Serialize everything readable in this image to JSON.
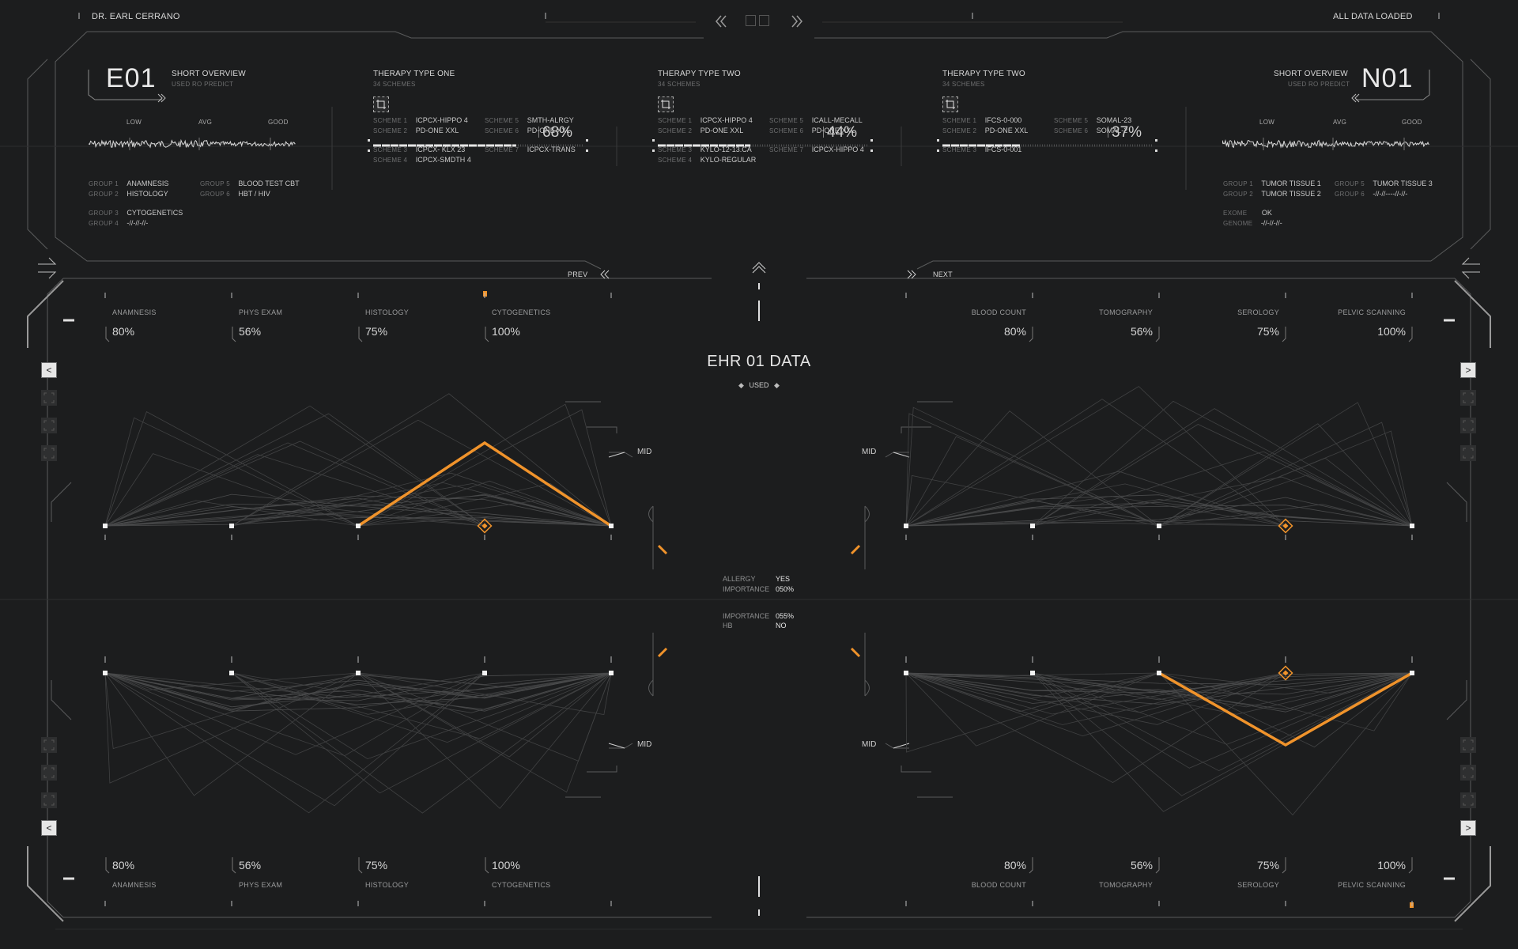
{
  "header": {
    "user": "DR. EARL CERRANO",
    "status": "ALL DATA LOADED",
    "prev_icon": "double-chevron-left-icon",
    "next_icon": "double-chevron-right-icon"
  },
  "top_left": {
    "code": "E01",
    "title": "SHORT OVERVIEW",
    "subtitle": "USED RO PREDICT",
    "scale": [
      "LOW",
      "AVG",
      "GOOD"
    ],
    "groups": [
      {
        "k": "GROUP 1",
        "v": "ANAMNESIS"
      },
      {
        "k": "GROUP 5",
        "v": "BLOOD TEST CBT"
      },
      {
        "k": "GROUP 2",
        "v": "HISTOLOGY"
      },
      {
        "k": "GROUP 6",
        "v": "HBT / HIV"
      },
      {
        "k": "GROUP 3",
        "v": "CYTOGENETICS"
      },
      {
        "k": "GROUP 4",
        "v": "-//-//-//-"
      }
    ]
  },
  "top_right": {
    "code": "N01",
    "title": "SHORT OVERVIEW",
    "subtitle": "USED RO PREDICT",
    "scale": [
      "LOW",
      "AVG",
      "GOOD"
    ],
    "groups": [
      {
        "k": "GROUP 1",
        "v": "TUMOR TISSUE 1"
      },
      {
        "k": "GROUP 5",
        "v": "TUMOR TISSUE 3"
      },
      {
        "k": "GROUP 2",
        "v": "TUMOR TISSUE 2"
      },
      {
        "k": "GROUP 6",
        "v": "-//-//----//-//-"
      },
      {
        "k": "EXOME",
        "v": "OK"
      },
      {
        "k": "GENOME",
        "v": "-//-//-//-"
      }
    ]
  },
  "therapies": [
    {
      "title": "THERAPY TYPE ONE",
      "subtitle": "34 SCHEMES",
      "percent": "68%",
      "fill": 0.68,
      "schemes": [
        {
          "k": "SCHEME 1",
          "v": "ICPCX-HIPPO 4"
        },
        {
          "k": "SCHEME 5",
          "v": "SMTH-ALRGY"
        },
        {
          "k": "SCHEME 2",
          "v": "PD-ONE XXL"
        },
        {
          "k": "SCHEME 6",
          "v": "PD-ONE XXL"
        },
        {
          "k": "SCHEME 3",
          "v": "ICPCX- KLX 23"
        },
        {
          "k": "SCHEME 7",
          "v": "ICPCX-TRANS"
        },
        {
          "k": "SCHEME 4",
          "v": "ICPCX-SMDTH 4"
        }
      ]
    },
    {
      "title": "THERAPY TYPE TWO",
      "subtitle": "34 SCHEMES",
      "percent": "44%",
      "fill": 0.44,
      "schemes": [
        {
          "k": "SCHEME 1",
          "v": "ICPCX-HIPPO 4"
        },
        {
          "k": "SCHEME 5",
          "v": "ICALL-MECALL"
        },
        {
          "k": "SCHEME 2",
          "v": "PD-ONE XXL"
        },
        {
          "k": "SCHEME 6",
          "v": "PD-ONE XXL"
        },
        {
          "k": "SCHEME 3",
          "v": "KYLO-12-13.CA"
        },
        {
          "k": "SCHEME 7",
          "v": "ICPCX-HIPPO 4"
        },
        {
          "k": "SCHEME 4",
          "v": "KYLO-REGULAR"
        }
      ]
    },
    {
      "title": "THERAPY TYPE TWO",
      "subtitle": "34 SCHEMES",
      "percent": "37%",
      "fill": 0.37,
      "schemes": [
        {
          "k": "SCHEME 1",
          "v": "IFCS-0-000"
        },
        {
          "k": "SCHEME 5",
          "v": "SOMAL-23"
        },
        {
          "k": "SCHEME 2",
          "v": "PD-ONE XXL"
        },
        {
          "k": "SCHEME 6",
          "v": "SOMAL-2"
        },
        {
          "k": "SCHEME 3",
          "v": "IFCS-0-001"
        }
      ]
    }
  ],
  "nav": {
    "prev": "PREV",
    "next": "NEXT"
  },
  "center": {
    "title": "EHR 01 DATA",
    "used": "USED",
    "info_top": [
      {
        "k": "ALLERGY",
        "v": "YES"
      },
      {
        "k": "IMPORTANCE",
        "v": "050%"
      }
    ],
    "info_bottom": [
      {
        "k": "IMPORTANCE",
        "v": "055%"
      },
      {
        "k": "HB",
        "v": "NO"
      }
    ],
    "mid": "MID"
  },
  "metrics_left": [
    {
      "label": "ANAMNESIS",
      "value": "80%"
    },
    {
      "label": "PHYS EXAM",
      "value": "56%"
    },
    {
      "label": "HISTOLOGY",
      "value": "75%"
    },
    {
      "label": "CYTOGENETICS",
      "value": "100%"
    }
  ],
  "metrics_right": [
    {
      "label": "BLOOD COUNT",
      "value": "80%"
    },
    {
      "label": "TOMOGRAPHY",
      "value": "56%"
    },
    {
      "label": "SEROLOGY",
      "value": "75%"
    },
    {
      "label": "PELVIC SCANNING",
      "value": "100%"
    }
  ],
  "colors": {
    "accent": "#f0932b",
    "line": "#4a4b4c",
    "bg": "#1c1d1e"
  }
}
